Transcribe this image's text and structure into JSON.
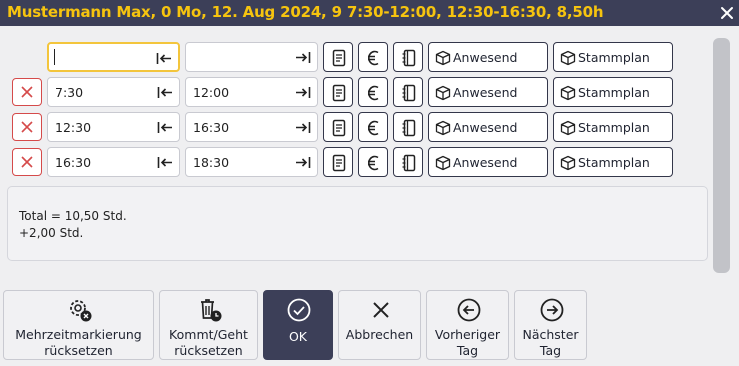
{
  "title": "Mustermann Max, 0 Mo, 12. Aug 2024, 9 7:30-12:00, 12:30-16:30, 8,50h",
  "rows": [
    {
      "from": "",
      "to": "",
      "btn_present": "Anwesend",
      "btn_plan": "Stammplan"
    },
    {
      "from": "7:30",
      "to": "12:00",
      "btn_present": "Anwesend",
      "btn_plan": "Stammplan"
    },
    {
      "from": "12:30",
      "to": "16:30",
      "btn_present": "Anwesend",
      "btn_plan": "Stammplan"
    },
    {
      "from": "16:30",
      "to": "18:30",
      "btn_present": "Anwesend",
      "btn_plan": "Stammplan"
    }
  ],
  "summary": {
    "total": "Total = 10,50 Std.",
    "diff": "+2,00 Std."
  },
  "footer": {
    "reset_marking": {
      "line1": "Mehrzeitmarkierung",
      "line2": "rücksetzen"
    },
    "reset_inout": {
      "line1": "Kommt/Geht",
      "line2": "rücksetzen"
    },
    "ok": "OK",
    "cancel": "Abbrechen",
    "previous": {
      "line1": "Vorheriger",
      "line2": "Tag"
    },
    "next": {
      "line1": "Nächster",
      "line2": "Tag"
    }
  },
  "colors": {
    "header_bg": "#3c3f58",
    "title_color": "#f6c40f",
    "delete_red": "#d54a4a",
    "focus_yellow": "#f3c53c"
  },
  "icons": [
    "close-icon",
    "delete-x-icon",
    "start-time-icon",
    "end-time-icon",
    "document-icon",
    "euro-icon",
    "notebook-icon",
    "box-icon",
    "gear-reset-icon",
    "trash-clock-icon",
    "check-circle-icon",
    "x-icon",
    "arrow-left-circle-icon",
    "arrow-right-circle-icon"
  ]
}
